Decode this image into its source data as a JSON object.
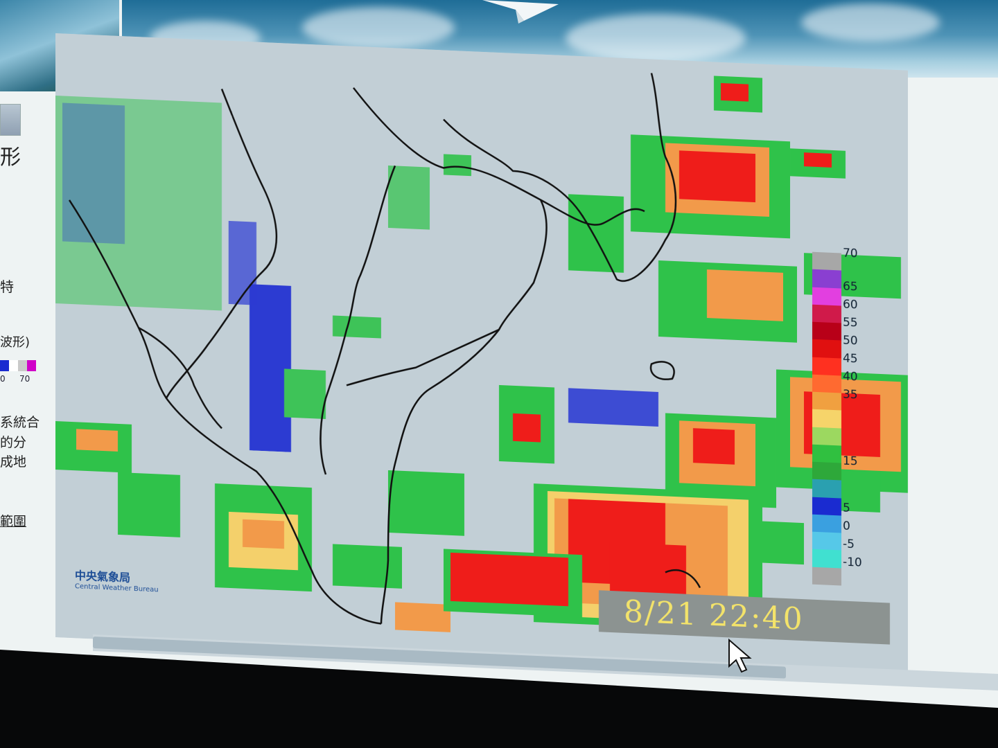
{
  "sidebar": {
    "title": "形",
    "line1": "特",
    "line2": "波形)",
    "scale_labels": [
      "0",
      "70"
    ],
    "scale_colors": [
      "#1a2bd0",
      "#ffffff",
      "#c9c9c9",
      "#d000c8"
    ],
    "desc": [
      "系統合",
      "的分",
      "成地"
    ],
    "link": "範圍"
  },
  "radar": {
    "copyright": "中央氣象局",
    "copyright_en": "Central Weather Bureau",
    "timestamp": "8/21 22:40",
    "legend": {
      "labels": [
        "70",
        "65",
        "60",
        "55",
        "50",
        "45",
        "40",
        "35",
        "15",
        "5",
        "0",
        "-5",
        "-10"
      ],
      "colors": [
        "#a7a7a7",
        "#8a3fd1",
        "#e23fe0",
        "#d01a4a",
        "#b80018",
        "#e01010",
        "#ff3020",
        "#ff6a30",
        "#f0a040",
        "#f6d46a",
        "#9cd860",
        "#30c040",
        "#2ea83a",
        "#2aa0b0",
        "#1a2bd0",
        "#3aa0e0",
        "#56c8e8",
        "#40e0d0",
        "#a7a7a7"
      ]
    },
    "colors": {
      "land": "#c2cfd6",
      "border": "#111111",
      "heavy": "#ef1d1a",
      "moderate": "#f29a4a",
      "light": "#f4d06b",
      "green": "#2fc24a",
      "blue": "#1b2bd2",
      "cyan": "#6cd6e6"
    }
  }
}
